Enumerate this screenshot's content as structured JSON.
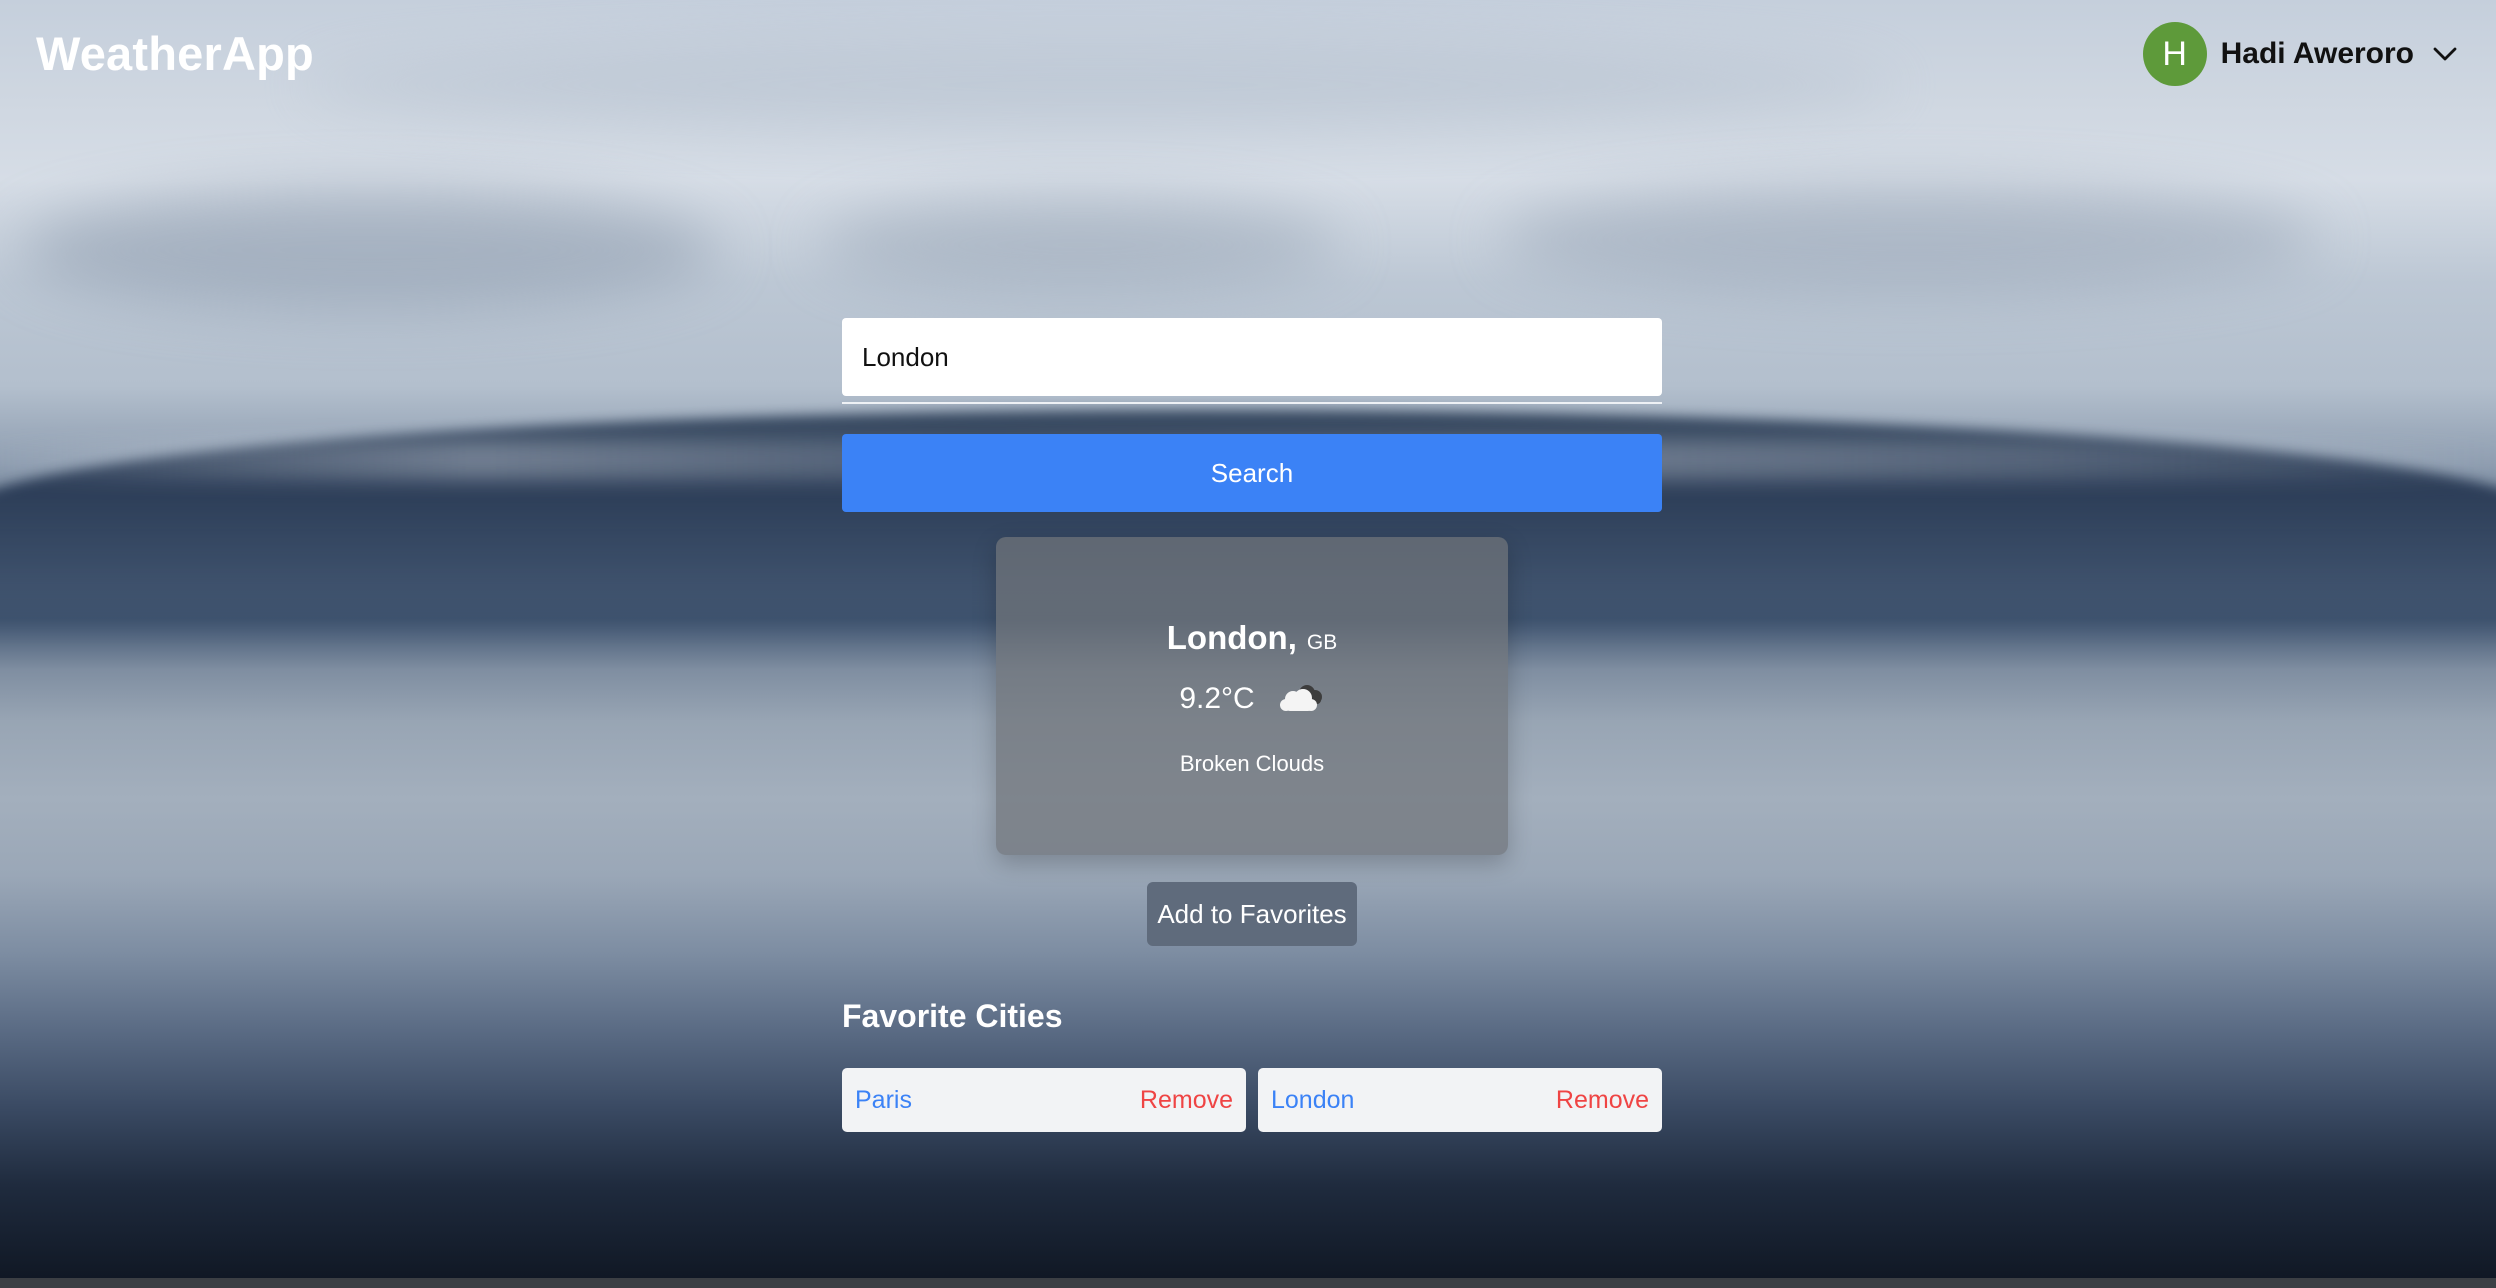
{
  "app": {
    "title": "WeatherApp"
  },
  "user": {
    "initial": "H",
    "name": "Hadi Aweroro",
    "avatar_color": "#5e9a3a"
  },
  "search": {
    "value": "London",
    "button_label": "Search",
    "accent_color": "#3b82f6"
  },
  "weather": {
    "city": "London,",
    "country": "GB",
    "temperature": "9.2°C",
    "icon": "broken-clouds-icon",
    "description": "Broken Clouds"
  },
  "actions": {
    "add_favorite_label": "Add to Favorites"
  },
  "favorites": {
    "title": "Favorite Cities",
    "items": [
      {
        "city": "Paris",
        "remove_label": "Remove"
      },
      {
        "city": "London",
        "remove_label": "Remove"
      }
    ],
    "remove_color": "#ef4444"
  }
}
